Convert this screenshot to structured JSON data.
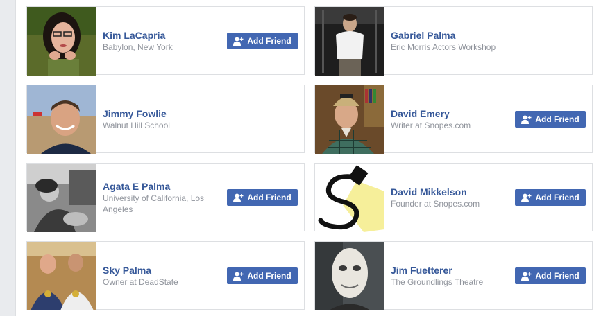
{
  "people": [
    {
      "name": "Kim LaCapria",
      "line1": "Babylon, New York",
      "line2": "",
      "button": "Add Friend",
      "photo": "woman-glasses-photo"
    },
    {
      "name": "Gabriel Palma",
      "line1": "Eric Morris Actors Workshop",
      "line2": "",
      "button": "",
      "photo": "man-white-shirt-photo"
    },
    {
      "name": "Jimmy Fowlie",
      "line1": "Walnut Hill School",
      "line2": "",
      "button": "",
      "photo": "man-smiling-desert-photo"
    },
    {
      "name": "David Emery",
      "line1_prefix": "Writer at ",
      "line1_link": "Snopes.com",
      "button": "Add Friend",
      "photo": "man-cap-plaid-photo"
    },
    {
      "name": "Agata E Palma",
      "line1": "University of California, Los",
      "line2": "Angeles",
      "button": "Add Friend",
      "photo": "woman-black-white-photo"
    },
    {
      "name": "David Mikkelson",
      "line1_prefix": "Founder at ",
      "line1_link": "Snopes.com",
      "button": "Add Friend",
      "photo": "snopes-logo-photo"
    },
    {
      "name": "Sky Palma",
      "line1": "Owner at DeadState",
      "line2": "",
      "button": "Add Friend",
      "photo": "two-men-medals-photo"
    },
    {
      "name": "Jim Fuetterer",
      "line1": "The Groundlings Theatre",
      "line2": "",
      "button": "Add Friend",
      "photo": "white-mask-photo"
    }
  ],
  "colors": {
    "link": "#365899",
    "button": "#4267b2",
    "subtext": "#90949c",
    "border": "#dddfe2"
  },
  "icons": {
    "add_friend": "add-friend-icon"
  }
}
